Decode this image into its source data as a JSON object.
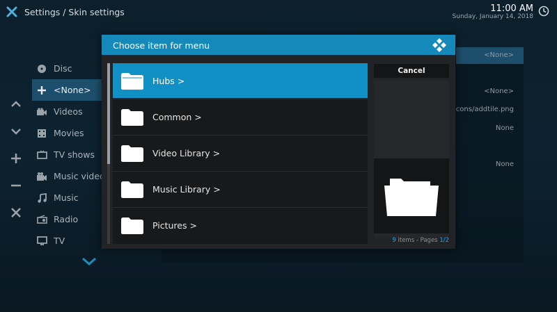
{
  "header": {
    "title": "Settings / Skin settings",
    "time": "11:00 AM",
    "date": "Sunday, January 14, 2018"
  },
  "sidebar": {
    "items": [
      {
        "label": "Disc",
        "icon": "disc-icon"
      },
      {
        "label": "<None>",
        "icon": "plus-icon"
      },
      {
        "label": "Videos",
        "icon": "video-camera-icon"
      },
      {
        "label": "Movies",
        "icon": "film-icon"
      },
      {
        "label": "TV shows",
        "icon": "tv-icon"
      },
      {
        "label": "Music videos",
        "icon": "music-video-icon"
      },
      {
        "label": "Music",
        "icon": "music-note-icon"
      },
      {
        "label": "Radio",
        "icon": "radio-icon"
      },
      {
        "label": "TV",
        "icon": "tv-icon"
      }
    ]
  },
  "background_values": {
    "v1": "<None>",
    "v2": "<None>",
    "v3": "cons/addtile.png",
    "v4": "None",
    "v5": "None"
  },
  "dialog": {
    "title": "Choose item for menu",
    "items": [
      {
        "label": "Hubs  >"
      },
      {
        "label": "Common  >"
      },
      {
        "label": "Video Library  >"
      },
      {
        "label": "Music Library  >"
      },
      {
        "label": "Pictures  >"
      }
    ],
    "cancel_label": "Cancel",
    "count_num": "9",
    "count_text": " items - Pages ",
    "page_num": "1/2"
  },
  "colors": {
    "accent": "#1190c6",
    "header_bar": "#1689bb",
    "highlight_text": "#15a7e8"
  }
}
